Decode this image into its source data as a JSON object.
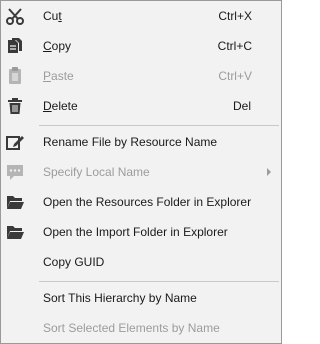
{
  "menu": {
    "cut": {
      "before": "Cu",
      "mnemonic": "t",
      "after": "",
      "shortcut": "Ctrl+X",
      "icon": "scissors-icon"
    },
    "copy": {
      "before": "",
      "mnemonic": "C",
      "after": "opy",
      "shortcut": "Ctrl+C",
      "icon": "copy-icon"
    },
    "paste": {
      "before": "",
      "mnemonic": "P",
      "after": "aste",
      "shortcut": "Ctrl+V",
      "icon": "clipboard-icon",
      "disabled": true
    },
    "delete": {
      "before": "",
      "mnemonic": "D",
      "after": "elete",
      "shortcut": "Del",
      "icon": "trash-icon"
    },
    "rename": {
      "label": "Rename File by Resource Name",
      "icon": "edit-icon"
    },
    "specify_local_name": {
      "label": "Specify Local Name",
      "icon": "speech-bubble-icon",
      "disabled": true
    },
    "open_resources": {
      "label": "Open the Resources Folder in Explorer",
      "icon": "folder-open-icon"
    },
    "open_import": {
      "label": "Open the Import Folder in Explorer",
      "icon": "folder-open-icon"
    },
    "copy_guid": {
      "label": "Copy GUID"
    },
    "sort_hierarchy": {
      "label": "Sort This Hierarchy by Name"
    },
    "sort_selected": {
      "label": "Sort Selected Elements by Name",
      "disabled": true
    }
  },
  "colors": {
    "background": "#f2f2f2",
    "text": "#1a1a1a",
    "disabled_text": "#9c9c9c",
    "separator": "#c8c8c8",
    "icon": "#3a3a3a"
  }
}
